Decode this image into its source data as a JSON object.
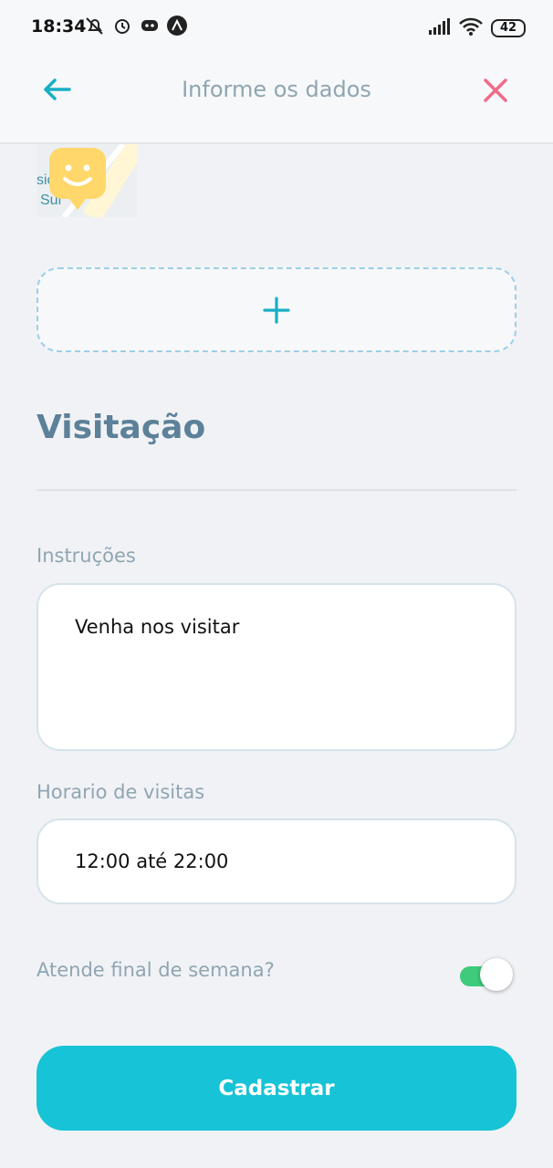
{
  "status_bar": {
    "time": "18:34",
    "battery": "42",
    "icons": [
      "mute-icon",
      "alarm-icon",
      "discord-icon",
      "app-icon",
      "signal-icon",
      "wifi-icon"
    ]
  },
  "header": {
    "title": "Informe os dados",
    "back_icon": "arrow-left-icon",
    "close_icon": "close-icon",
    "accent_color": "#17afc4",
    "close_color": "#f06a8a"
  },
  "map_thumb": {
    "text_line1": "sic",
    "text_line2": "Sul"
  },
  "add_photo": {
    "icon": "plus-icon"
  },
  "section": {
    "title": "Visitação"
  },
  "instructions": {
    "label": "Instruções",
    "value": "Venha nos visitar"
  },
  "hours": {
    "label": "Horario de visitas",
    "value": "12:00 até 22:00"
  },
  "weekend": {
    "label": "Atende final de semana?",
    "enabled": true,
    "on_color": "#3ecb7c"
  },
  "submit": {
    "label": "Cadastrar",
    "color": "#17c3d6"
  }
}
